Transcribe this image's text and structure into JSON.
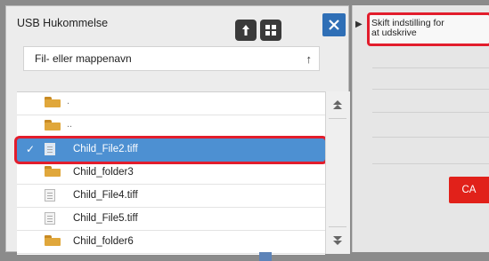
{
  "dialog": {
    "title": "USB Hukommelse",
    "search_placeholder": "Fil- eller mappenavn",
    "sort_glyph": "↑",
    "up_glyph": "⮬",
    "grid_glyph": "▦",
    "close_glyph": "✕"
  },
  "list": {
    "parent_dots_1": ".",
    "parent_dots_2": "..",
    "items": [
      {
        "name": "Child_File2.tiff",
        "type": "file",
        "selected": true
      },
      {
        "name": "Child_folder3",
        "type": "folder"
      },
      {
        "name": "Child_File4.tiff",
        "type": "file"
      },
      {
        "name": "Child_File5.tiff",
        "type": "file"
      },
      {
        "name": "Child_folder6",
        "type": "folder"
      }
    ],
    "check_glyph": "✓"
  },
  "scroll": {
    "up": "⇞",
    "down": "⇟"
  },
  "right_panel": {
    "arrow": "▶",
    "setting_line1": "Skift indstilling for",
    "setting_line2": "at udskrive",
    "ca_label": "CA"
  },
  "colors": {
    "accent_blue": "#4d90d2",
    "highlight_red": "#e21d2c",
    "ca_red": "#e1211a"
  }
}
